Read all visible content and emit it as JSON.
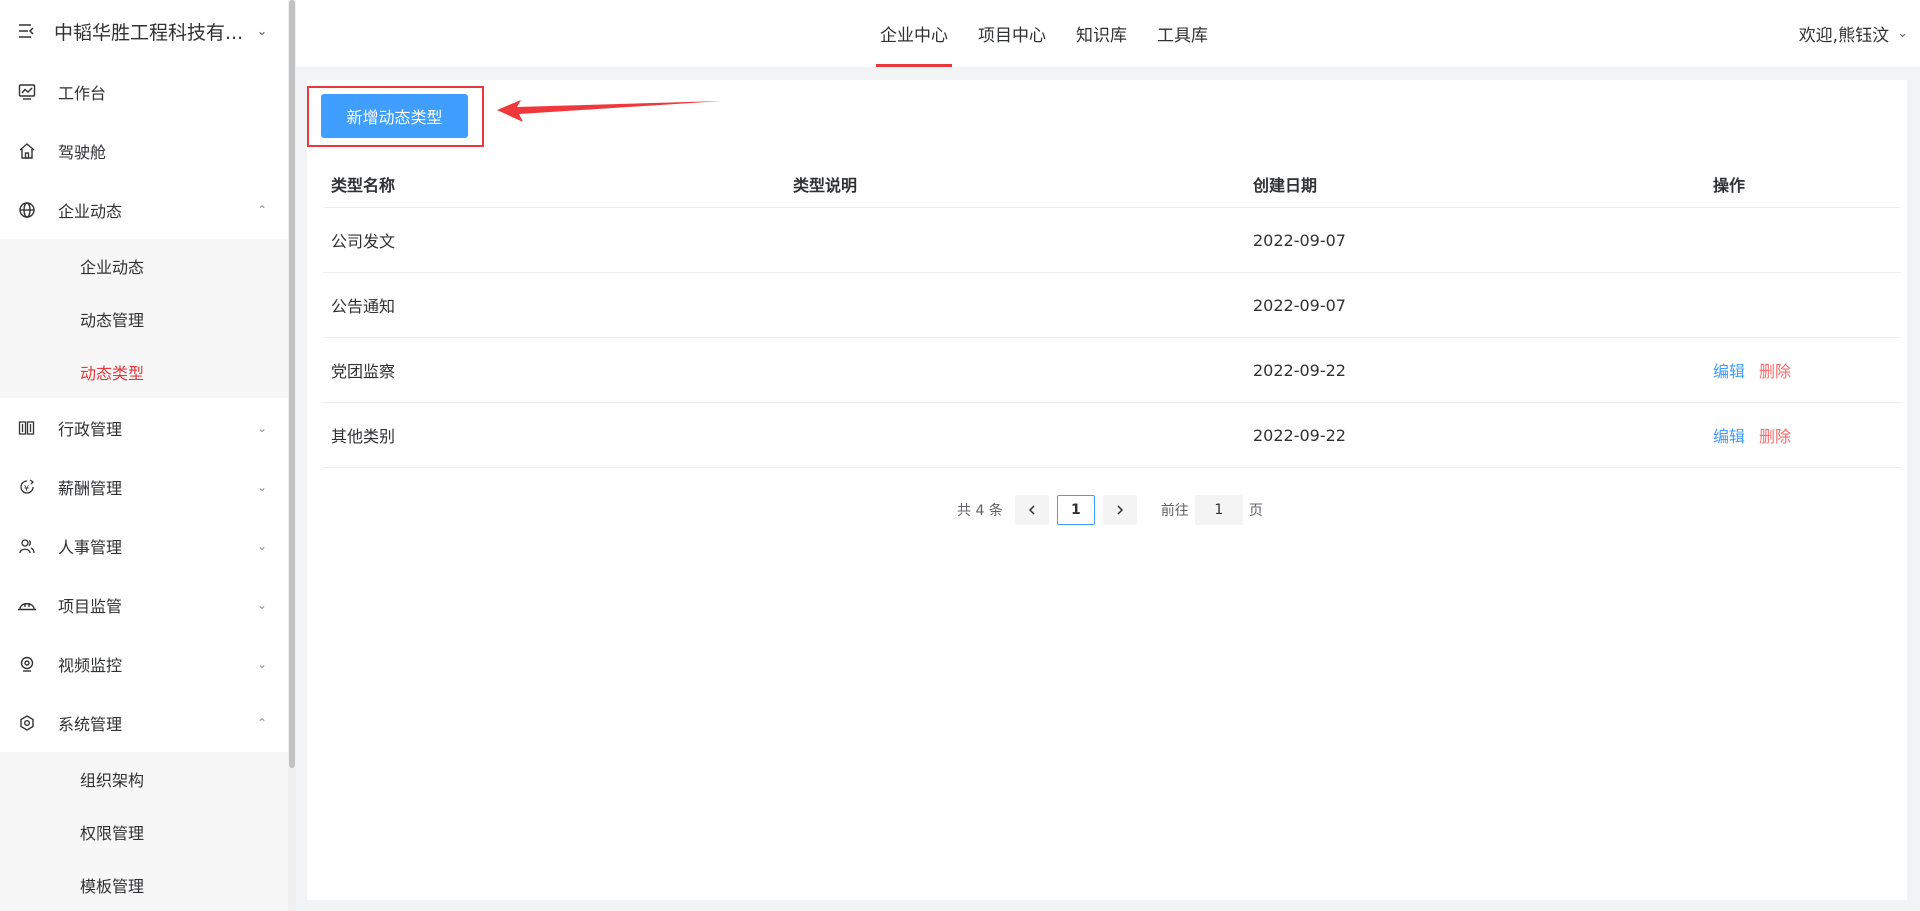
{
  "brand": {
    "title": "中韬华胜工程科技有...",
    "icon": "menu-fold-icon"
  },
  "sidebar": {
    "items": [
      {
        "label": "工作台",
        "icon": "chart-monitor-icon"
      },
      {
        "label": "驾驶舱",
        "icon": "home-icon"
      },
      {
        "label": "企业动态",
        "icon": "globe-icon",
        "expanded": true,
        "children": [
          "企业动态",
          "动态管理",
          "动态类型"
        ],
        "active_child": "动态类型"
      },
      {
        "label": "行政管理",
        "icon": "building-icon"
      },
      {
        "label": "薪酬管理",
        "icon": "salary-icon"
      },
      {
        "label": "人事管理",
        "icon": "users-icon"
      },
      {
        "label": "项目监管",
        "icon": "hardhat-icon"
      },
      {
        "label": "视频监控",
        "icon": "camera-icon"
      },
      {
        "label": "系统管理",
        "icon": "settings-icon",
        "expanded": true,
        "children": [
          "组织架构",
          "权限管理",
          "模板管理"
        ]
      }
    ]
  },
  "header": {
    "tabs": [
      "企业中心",
      "项目中心",
      "知识库",
      "工具库"
    ],
    "active_tab": "企业中心",
    "user": "欢迎,熊钰汶"
  },
  "toolbar": {
    "add_label": "新增动态类型"
  },
  "table": {
    "headers": [
      "类型名称",
      "类型说明",
      "创建日期",
      "操作"
    ],
    "rows": [
      {
        "name": "公司发文",
        "desc": "",
        "date": "2022-09-07",
        "edit": "",
        "delete": ""
      },
      {
        "name": "公告通知",
        "desc": "",
        "date": "2022-09-07",
        "edit": "",
        "delete": ""
      },
      {
        "name": "党团监察",
        "desc": "",
        "date": "2022-09-22",
        "edit": "编辑",
        "delete": "删除"
      },
      {
        "name": "其他类别",
        "desc": "",
        "date": "2022-09-22",
        "edit": "编辑",
        "delete": "删除"
      }
    ]
  },
  "pagination": {
    "total": "共 4 条",
    "current": "1",
    "goto_label": "前往",
    "goto_value": "1",
    "page_suffix": "页"
  },
  "colors": {
    "accent": "#e8383d",
    "primary": "#409eff",
    "danger": "#f56c6c"
  }
}
